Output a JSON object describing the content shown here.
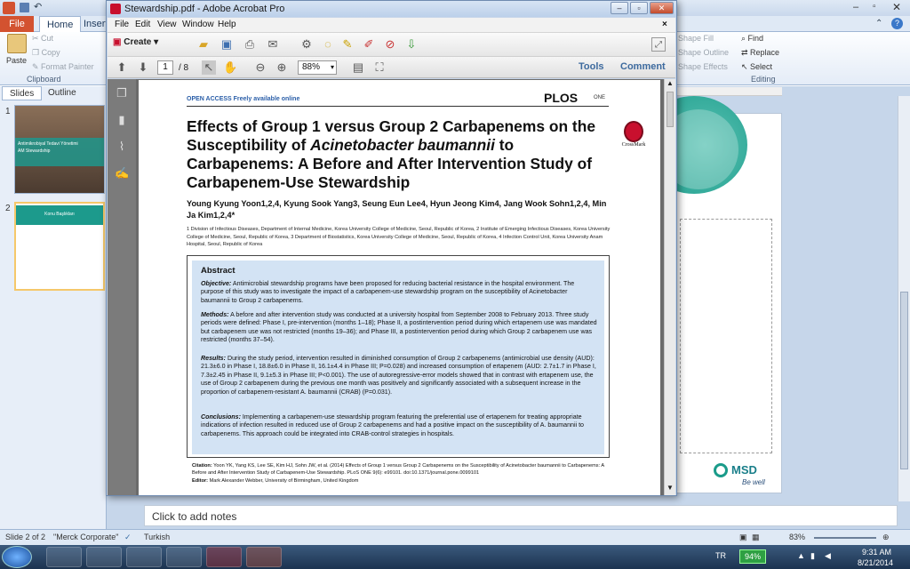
{
  "powerpoint": {
    "tabs": [
      "File",
      "Home",
      "Insert"
    ],
    "ribbon": {
      "paste": "Paste",
      "cut": "Cut",
      "copy": "Copy",
      "format_painter": "Format Painter",
      "clipboard_group": "Clipboard",
      "shape_fill": "Shape Fill",
      "shape_outline": "Shape Outline",
      "shape_effects": "Shape Effects",
      "find": "Find",
      "replace": "Replace",
      "select": "Select",
      "editing_group": "Editing"
    },
    "panel_tabs": [
      "Slides",
      "Outline"
    ],
    "slides": [
      {
        "number": "1",
        "caption_line1": "Antimikrobiyal Tedavi Yönetimi",
        "caption_line2": "AM Stewardship"
      },
      {
        "number": "2",
        "caption_line1": "Konu Başlıkları"
      }
    ],
    "notes_placeholder": "Click to add notes",
    "status": {
      "slide": "Slide 2 of 2",
      "theme": "\"Merck Corporate\"",
      "language": "Turkish",
      "zoom": "83%"
    },
    "slide_brand": {
      "logo": "MSD",
      "tagline": "Be well"
    }
  },
  "taskbar": {
    "language": "TR",
    "battery": "94%",
    "time": "9:31 AM",
    "date": "8/21/2014"
  },
  "acrobat": {
    "title": "Stewardship.pdf - Adobe Acrobat Pro",
    "menu": [
      "File",
      "Edit",
      "View",
      "Window",
      "Help"
    ],
    "create_label": "Create",
    "page_current": "1",
    "page_total": "/ 8",
    "zoom": "88%",
    "tools_label": "Tools",
    "comment_label": "Comment"
  },
  "pdf": {
    "open_access": "OPEN ACCESS  Freely available online",
    "journal": "PLOS",
    "journal_suffix": "ONE",
    "crossmark": "CrossMark",
    "title_line1": "Effects of Group 1 versus Group 2 Carbapenems on the",
    "title_line2a": "Susceptibility of ",
    "title_line2b": "Acinetobacter baumannii",
    "title_line2c": " to",
    "title_line3": "Carbapenems: A Before and After Intervention Study of",
    "title_line4": "Carbapenem-Use Stewardship",
    "authors": "Young Kyung Yoon1,2,4, Kyung Sook Yang3, Seung Eun Lee4, Hyun Jeong Kim4, Jang Wook Sohn1,2,4, Min Ja Kim1,2,4*",
    "affiliations": "1 Division of Infectious Diseases, Department of Internal Medicine, Korea University College of Medicine, Seoul, Republic of Korea, 2 Institute of Emerging Infectious Diseases, Korea University College of Medicine, Seoul, Republic of Korea, 3 Department of Biostatistics, Korea University College of Medicine, Seoul, Republic of Korea, 4 Infection Control Unit, Korea University Anam Hospital, Seoul, Republic of Korea",
    "abstract_heading": "Abstract",
    "objective_label": "Objective:",
    "objective": " Antimicrobial stewardship programs have been proposed for reducing bacterial resistance in the hospital environment. The purpose of this study was to investigate the impact of a carbapenem-use stewardship program on the susceptibility of Acinetobacter baumannii to Group 2 carbapenems.",
    "methods_label": "Methods:",
    "methods": " A before and after intervention study was conducted at a university hospital from September 2008 to February 2013. Three study periods were defined: Phase I, pre-intervention (months 1–18); Phase II, a postintervention period during which ertapenem use was mandated but carbapenem use was not restricted (months 19–36); and Phase III, a postintervention period during which Group 2 carbapenem use was restricted (months 37–54).",
    "results_label": "Results:",
    "results": " During the study period, intervention resulted in diminished consumption of Group 2 carbapenems (antimicrobial use density (AUD): 21.3±6.0 in Phase I, 18.8±6.0 in Phase II, 16.1±4.4 in Phase III; P=0.028) and increased consumption of ertapenem (AUD: 2.7±1.7 in Phase I, 7.3±2.45 in Phase II, 9.1±5.3 in Phase III; P<0.001). The use of autoregressive-error models showed that in contrast with ertapenem use, the use of Group 2 carbapenem during the previous one month was positively and significantly associated with a subsequent increase in the proportion of carbapenem-resistant A. baumannii (CRAB) (P=0.031).",
    "conclusions_label": "Conclusions:",
    "conclusions": " Implementing a carbapenem-use stewardship program featuring the preferential use of ertapenem for treating appropriate indications of infection resulted in reduced use of Group 2 carbapenems and had a positive impact on the susceptibility of A. baumannii to carbapenems. This approach could be integrated into CRAB-control strategies in hospitals.",
    "citation_label": "Citation:",
    "citation": " Yoon YK, Yang KS, Lee SE, Kim HJ, Sohn JW, et al. (2014) Effects of Group 1 versus Group 2 Carbapenems on the Susceptibility of Acinetobacter baumannii to Carbapenems: A Before and After Intervention Study of Carbapenem-Use Stewardship. PLoS ONE 9(6): e99101. doi:10.1371/journal.pone.0099101",
    "editor_label": "Editor:",
    "editor": " Mark Alexander Webber, University of Birmingham, United Kingdom"
  }
}
